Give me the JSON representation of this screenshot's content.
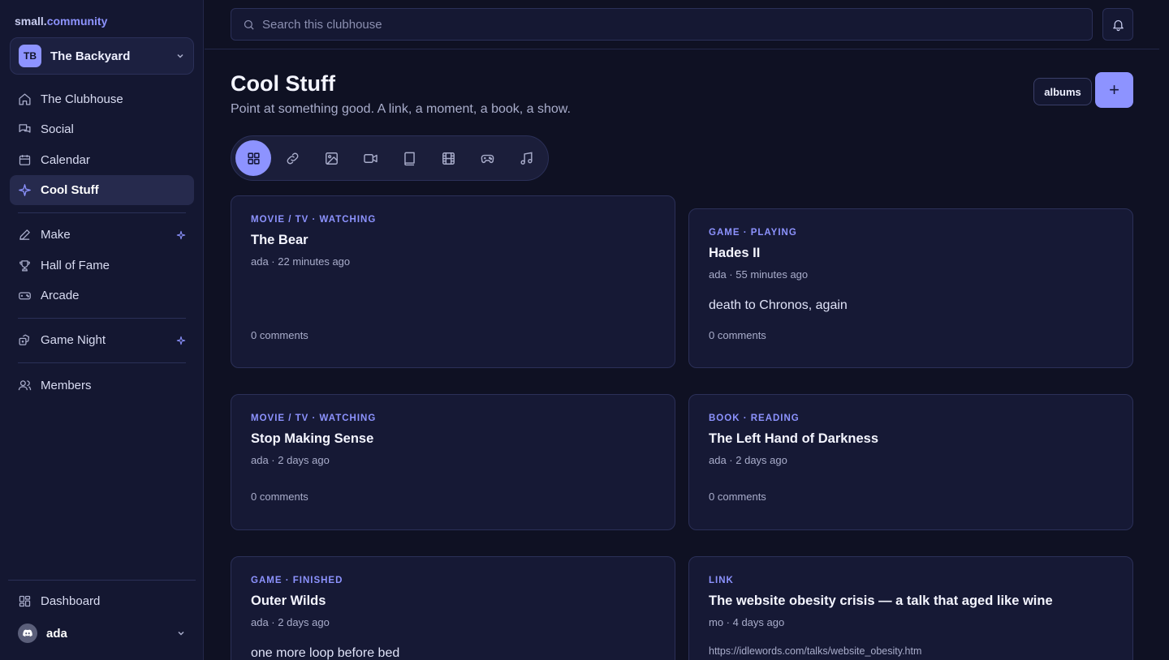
{
  "brand": {
    "prefix": "small.",
    "accent": "community"
  },
  "workspace": {
    "initials": "TB",
    "name": "The Backyard"
  },
  "sidebar": {
    "items": [
      {
        "label": "The Clubhouse"
      },
      {
        "label": "Social"
      },
      {
        "label": "Calendar"
      },
      {
        "label": "Cool Stuff"
      },
      {
        "label": "Make"
      },
      {
        "label": "Hall of Fame"
      },
      {
        "label": "Arcade"
      },
      {
        "label": "Game Night"
      },
      {
        "label": "Members"
      }
    ],
    "dashboard": "Dashboard",
    "user": "ada"
  },
  "search": {
    "placeholder": "Search this clubhouse"
  },
  "page": {
    "title": "Cool Stuff",
    "subtitle": "Point at something good. A link, a moment, a book, a show.",
    "albums_label": "albums",
    "add_label": "+"
  },
  "filters": [
    "grid-icon",
    "link-icon",
    "image-icon",
    "video-icon",
    "book-icon",
    "film-icon",
    "gamepad-icon",
    "music-icon"
  ],
  "cards": [
    {
      "kind": "MOVIE / TV · WATCHING",
      "title": "The Bear",
      "meta": "ada · 22 minutes ago",
      "comments": "0 comments"
    },
    {
      "kind": "GAME · PLAYING",
      "title": "Hades II",
      "meta": "ada · 55 minutes ago",
      "body": "death to Chronos, again",
      "comments": "0 comments"
    },
    {
      "kind": "MOVIE / TV · WATCHING",
      "title": "Stop Making Sense",
      "meta": "ada · 2 days ago",
      "comments": "0 comments"
    },
    {
      "kind": "BOOK · READING",
      "title": "The Left Hand of Darkness",
      "meta": "ada · 2 days ago",
      "comments": "0 comments"
    },
    {
      "kind": "GAME · FINISHED",
      "title": "Outer Wilds",
      "meta": "ada · 2 days ago",
      "body": "one more loop before bed"
    },
    {
      "kind": "LINK",
      "title": "The website obesity crisis — a talk that aged like wine",
      "meta": "mo · 4 days ago",
      "link": "https://idlewords.com/talks/website_obesity.htm"
    }
  ],
  "colors": {
    "accent": "#8d93ff",
    "background": "#0f1123",
    "sidebar": "#141731",
    "card": "#161935"
  }
}
